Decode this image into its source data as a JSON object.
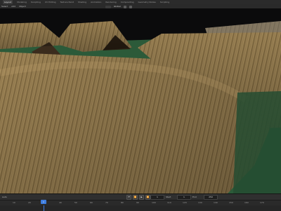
{
  "topbar": {
    "tabs": [
      "Layout",
      "Modeling",
      "Sculpting",
      "UV Editing",
      "Texture Paint",
      "Shading",
      "Animation",
      "Rendering",
      "Compositing",
      "Geometry Nodes",
      "Scripting"
    ]
  },
  "viewport_header": {
    "menus": [
      "Select",
      "Add",
      "Object"
    ],
    "transform_orientation": "Global"
  },
  "timeline": {
    "left_label": "Auto",
    "current_frame": "1",
    "start_label": "Start",
    "start": "1",
    "end_label": "End",
    "end": "250",
    "playhead_frame": "1",
    "ticks": [
      "10",
      "20",
      "30",
      "40",
      "50",
      "60",
      "70",
      "80",
      "90",
      "100",
      "110",
      "120",
      "130",
      "140",
      "150",
      "160",
      "170",
      "180",
      "190",
      "200",
      "210",
      "220",
      "230",
      "240",
      "250"
    ]
  },
  "scene": {
    "colors": {
      "sky": "#0b0b0c",
      "grass": "#2c5a39",
      "straw_light": "#a88c58",
      "straw_dark": "#6f5a35"
    }
  }
}
